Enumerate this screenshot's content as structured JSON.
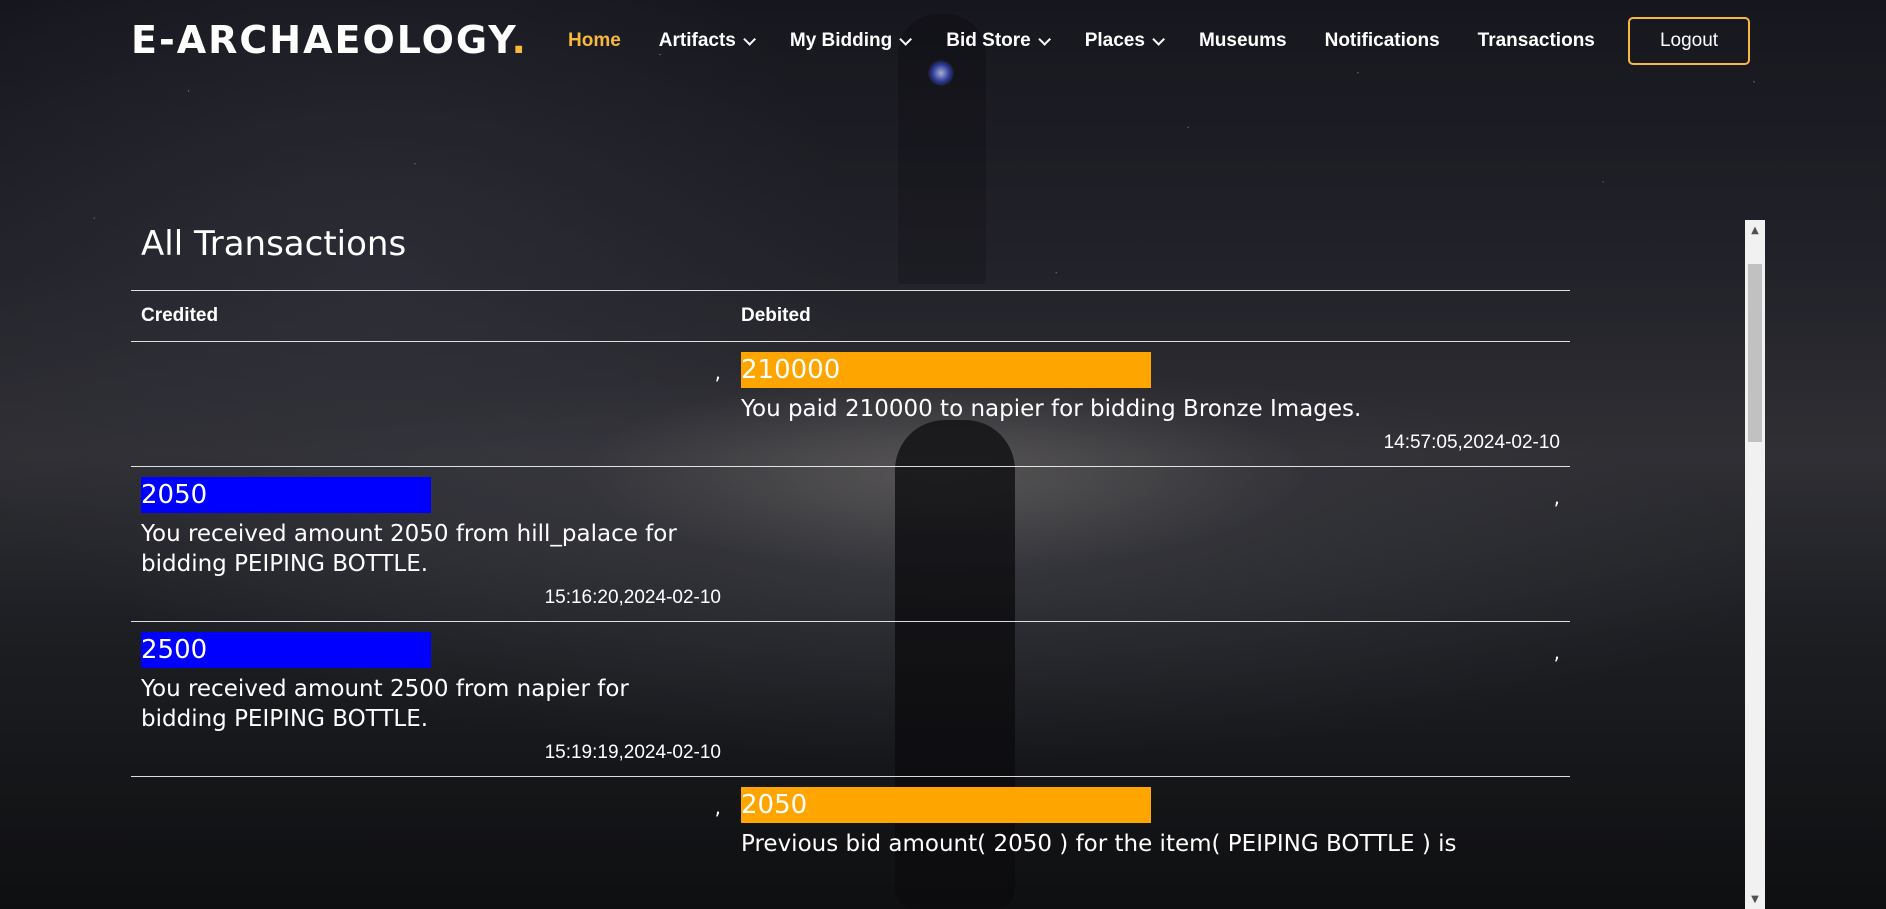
{
  "brand": {
    "name": "E-ARCHAEOLOGY",
    "dot": ".",
    "accent_color": "#f6b93b"
  },
  "nav": {
    "items": [
      {
        "label": "Home",
        "active": true,
        "dropdown": false
      },
      {
        "label": "Artifacts",
        "active": false,
        "dropdown": true
      },
      {
        "label": "My Bidding",
        "active": false,
        "dropdown": true
      },
      {
        "label": "Bid Store",
        "active": false,
        "dropdown": true
      },
      {
        "label": "Places",
        "active": false,
        "dropdown": true
      },
      {
        "label": "Museums",
        "active": false,
        "dropdown": false
      },
      {
        "label": "Notifications",
        "active": false,
        "dropdown": false
      },
      {
        "label": "Transactions",
        "active": false,
        "dropdown": false
      }
    ],
    "logout_label": "Logout"
  },
  "page": {
    "title": "All Transactions"
  },
  "table": {
    "headers": {
      "credited": "Credited",
      "debited": "Debited"
    },
    "credit_color": "#0000ff",
    "debit_color": "#ffa500",
    "rows": [
      {
        "type": "debit",
        "amount": "210000",
        "description": "You paid 210000 to napier for bidding Bronze Images.",
        "time": "14:57:05,2024-02-10",
        "comma": ","
      },
      {
        "type": "credit",
        "amount": "2050",
        "description": "You received amount 2050 from hill_palace for bidding PEIPING BOTTLE.",
        "time": "15:16:20,2024-02-10",
        "comma": ","
      },
      {
        "type": "credit",
        "amount": "2500",
        "description": "You received amount 2500 from napier for bidding PEIPING BOTTLE.",
        "time": "15:19:19,2024-02-10",
        "comma": ","
      },
      {
        "type": "debit",
        "amount": "2050",
        "description": "Previous bid amount( 2050 ) for the item( PEIPING BOTTLE ) is",
        "time": "",
        "comma": ","
      }
    ]
  },
  "scrollbar": {
    "up_icon": "▲",
    "down_icon": "▼"
  }
}
